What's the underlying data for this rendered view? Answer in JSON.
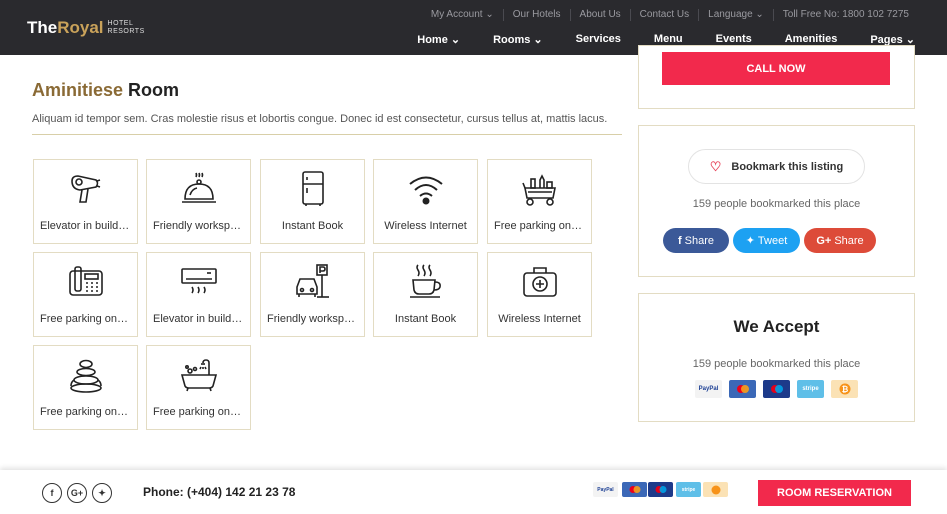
{
  "header": {
    "logo_the": "The",
    "logo_royal": "Royal",
    "logo_sub1": "HOTEL",
    "logo_sub2": "RESORTS",
    "top_links": [
      "My Account ⌄",
      "Our Hotels",
      "About Us",
      "Contact Us",
      "Language ⌄",
      "Toll Free No: 1800 102 7275"
    ],
    "main_nav": [
      "Home ⌄",
      "Rooms ⌄",
      "Services",
      "Menu",
      "Events",
      "Amenities",
      "Pages ⌄"
    ]
  },
  "main": {
    "title_accent": "Aminitiese",
    "title_rest": " Room",
    "description": "Aliquam id tempor sem. Cras molestie risus et lobortis congue. Donec id est consectetur, cursus tellus at, mattis lacus.",
    "amenities": [
      {
        "label": "Elevator in building",
        "icon": "hair-dryer-icon"
      },
      {
        "label": "Friendly workspace",
        "icon": "room-service-icon"
      },
      {
        "label": "Instant Book",
        "icon": "fridge-icon"
      },
      {
        "label": "Wireless Internet",
        "icon": "wifi-icon"
      },
      {
        "label": "Free parking on premises",
        "icon": "bar-cart-icon"
      },
      {
        "label": "Free parking on premises",
        "icon": "telephone-icon"
      },
      {
        "label": "Elevator in building",
        "icon": "air-conditioner-icon"
      },
      {
        "label": "Friendly workspace",
        "icon": "parking-car-icon"
      },
      {
        "label": "Instant Book",
        "icon": "coffee-cup-icon"
      },
      {
        "label": "Wireless Internet",
        "icon": "first-aid-kit-icon"
      },
      {
        "label": "Free parking on premises",
        "icon": "spa-stones-icon"
      },
      {
        "label": "Free parking on premises",
        "icon": "bathtub-icon"
      }
    ]
  },
  "sidebar": {
    "call_now": "CALL NOW",
    "bookmark_label": "Bookmark this listing",
    "bookmark_count": "159 people bookmarked this place",
    "share_facebook": "Share",
    "share_twitter": "Tweet",
    "share_google": "Share",
    "accept_title": "We Accept",
    "accept_count": "159 people bookmarked this place",
    "payments": [
      "PayPal",
      "Mastercard",
      "Maestro",
      "Stripe",
      "Bitcoin"
    ]
  },
  "footer": {
    "phone": "Phone: (+404) 142 21 23 78",
    "reserve": "ROOM RESERVATION"
  },
  "colors": {
    "accent": "#f2294c",
    "gold": "#8a6a35",
    "facebook": "#3b5998",
    "twitter": "#1da1f2",
    "google": "#dd4b39"
  }
}
